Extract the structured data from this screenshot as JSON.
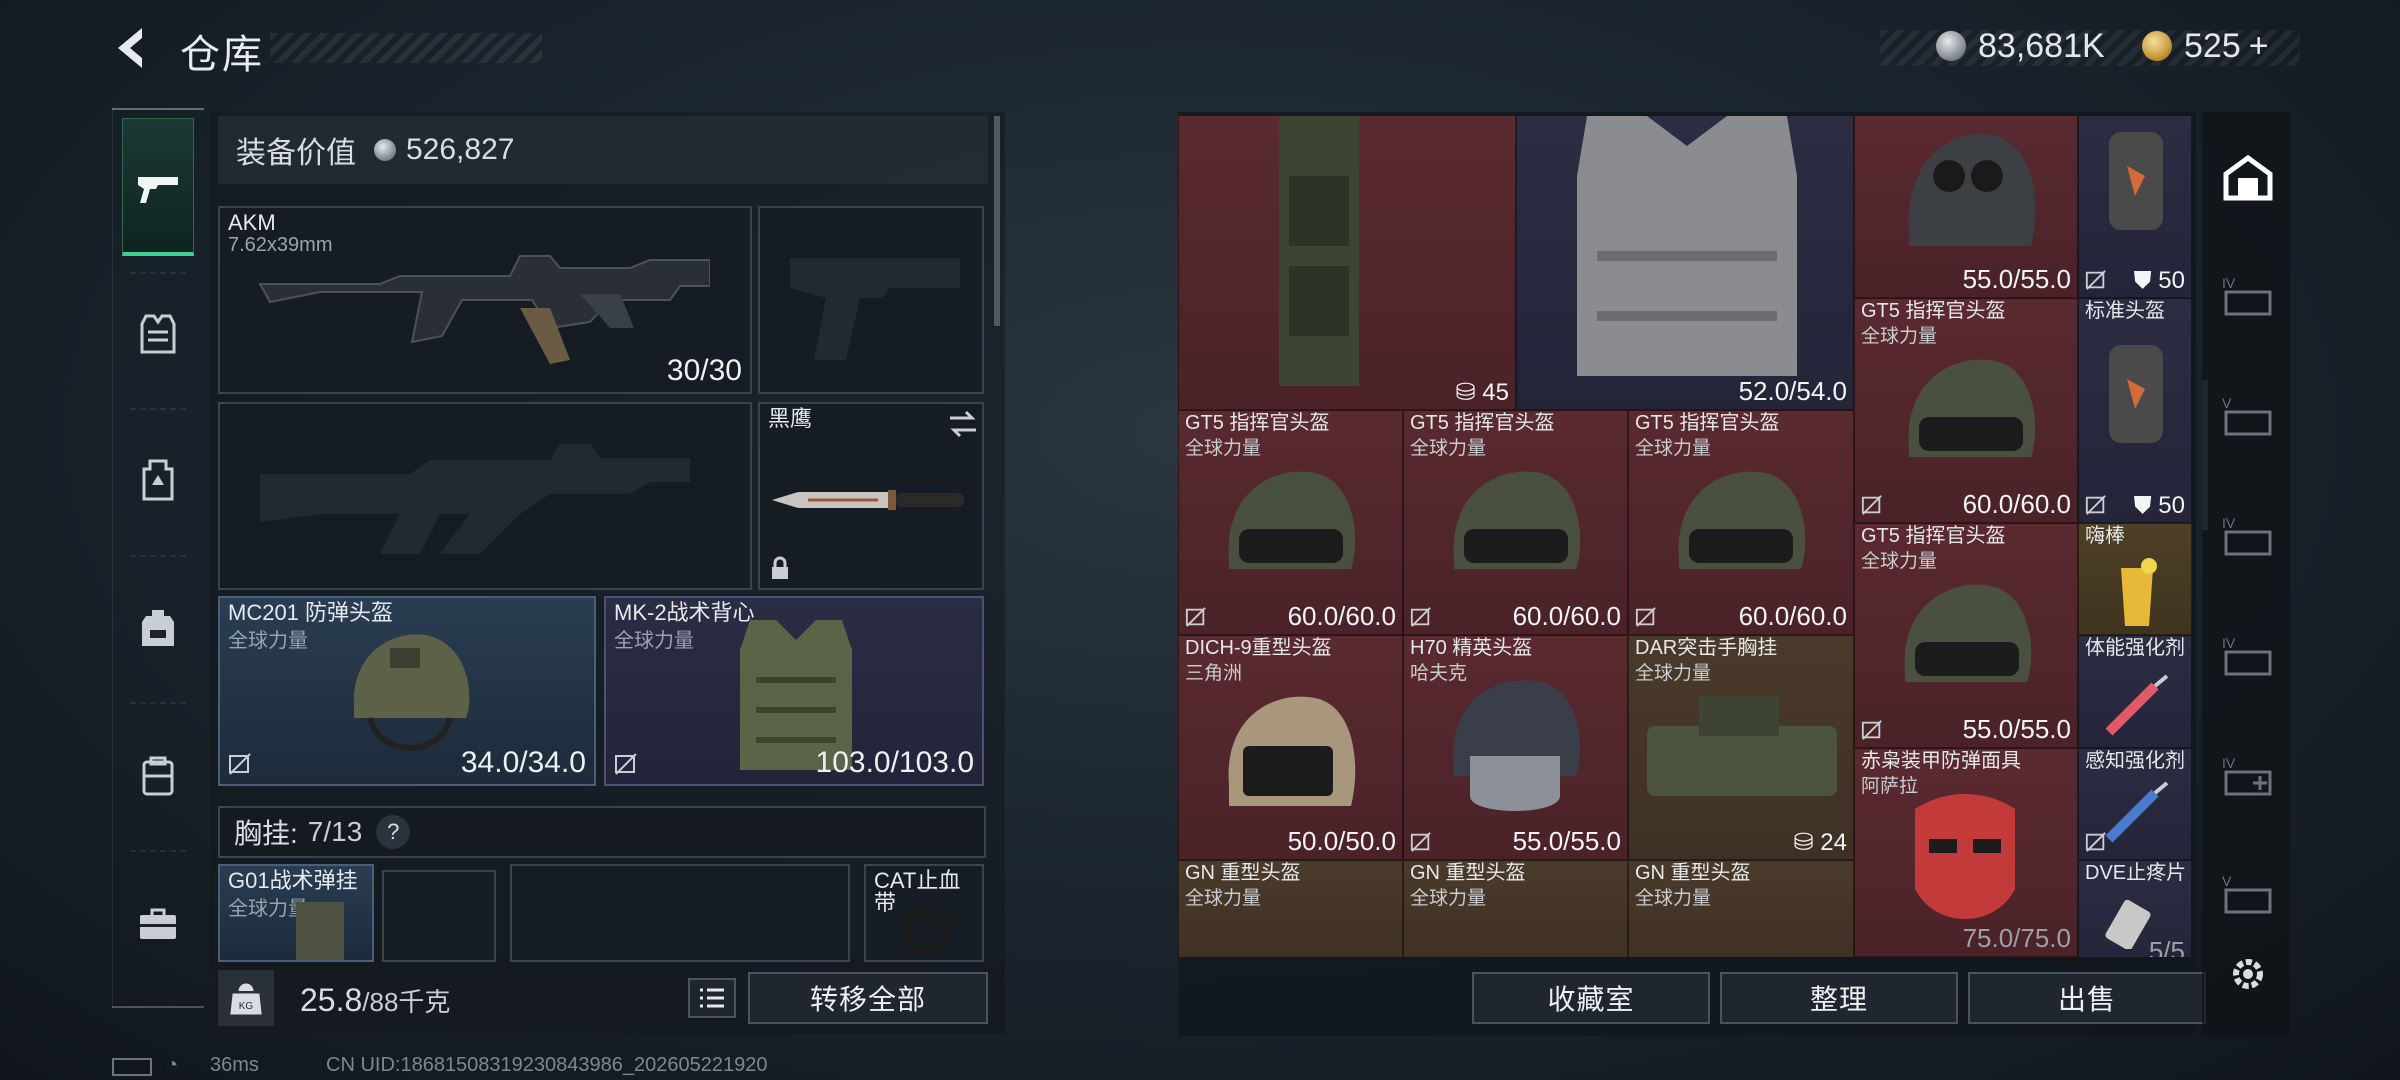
{
  "header": {
    "title": "仓库",
    "currency_silver": "83,681K",
    "currency_gold": "525",
    "currency_gold_add": "+"
  },
  "loadout": {
    "value_label": "装备价值",
    "value": "526,827",
    "primary": {
      "name": "AKM",
      "caliber": "7.62x39mm",
      "ammo": "30/30"
    },
    "melee": {
      "name": "黑鹰"
    },
    "helmet": {
      "name": "MC201 防弹头盔",
      "faction": "全球力量",
      "durability": "34.0/34.0"
    },
    "armor": {
      "name": "MK-2战术背心",
      "faction": "全球力量",
      "durability": "103.0/103.0"
    },
    "chest_label": "胸挂:",
    "chest_count": "7/13",
    "chest_help": "?",
    "rig": {
      "name": "G01战术弹挂",
      "faction": "全球力量"
    },
    "medkit": {
      "name": "CAT止血带"
    },
    "weight_value": "25.8",
    "weight_max": "/88千克",
    "transfer_all": "转移全部"
  },
  "stash": {
    "backpack_count": "45",
    "vest_durability": "52.0/54.0",
    "nvg_helmet_durability": "55.0/55.0",
    "armor_plate_value": "50",
    "items": [
      {
        "name": "GT5 指挥官头盔",
        "faction": "全球力量",
        "durability": "60.0/60.0"
      },
      {
        "name": "标准头盔",
        "faction": "",
        "durability": "50"
      },
      {
        "name": "GT5 指挥官头盔",
        "faction": "全球力量",
        "durability": "60.0/60.0"
      },
      {
        "name": "GT5 指挥官头盔",
        "faction": "全球力量",
        "durability": "60.0/60.0"
      },
      {
        "name": "GT5 指挥官头盔",
        "faction": "全球力量",
        "durability": "60.0/60.0"
      },
      {
        "name": "GT5 指挥官头盔",
        "faction": "全球力量",
        "durability": "55.0/55.0"
      },
      {
        "name": "嗨棒",
        "faction": "",
        "durability": ""
      },
      {
        "name": "DICH-9重型头盔",
        "faction": "三角洲",
        "durability": "50.0/50.0"
      },
      {
        "name": "H70 精英头盔",
        "faction": "哈夫克",
        "durability": "55.0/55.0"
      },
      {
        "name": "DAR突击手胸挂",
        "faction": "全球力量",
        "durability": "24"
      },
      {
        "name": "体能强化剂",
        "faction": "",
        "durability": ""
      },
      {
        "name": "赤枭装甲防弹面具",
        "faction": "阿萨拉",
        "durability": "75.0/75.0"
      },
      {
        "name": "感知强化剂",
        "faction": "",
        "durability": ""
      },
      {
        "name": "GN 重型头盔",
        "faction": "全球力量",
        "durability": ""
      },
      {
        "name": "GN 重型头盔",
        "faction": "全球力量",
        "durability": ""
      },
      {
        "name": "GN 重型头盔",
        "faction": "全球力量",
        "durability": ""
      },
      {
        "name": "DVE止疼片",
        "faction": "",
        "durability": "5/5"
      }
    ],
    "btn_collection": "收藏室",
    "btn_sort": "整理",
    "btn_sell": "出售"
  },
  "status": {
    "ping": "36ms",
    "uid": "CN UID:18681508319230843986_202605221920"
  },
  "colors": {
    "accent_green": "#3fcf8e",
    "red_rarity": "#5a2a30",
    "purple_rarity": "#2c2c42",
    "gold_rarity": "#4e4026"
  }
}
